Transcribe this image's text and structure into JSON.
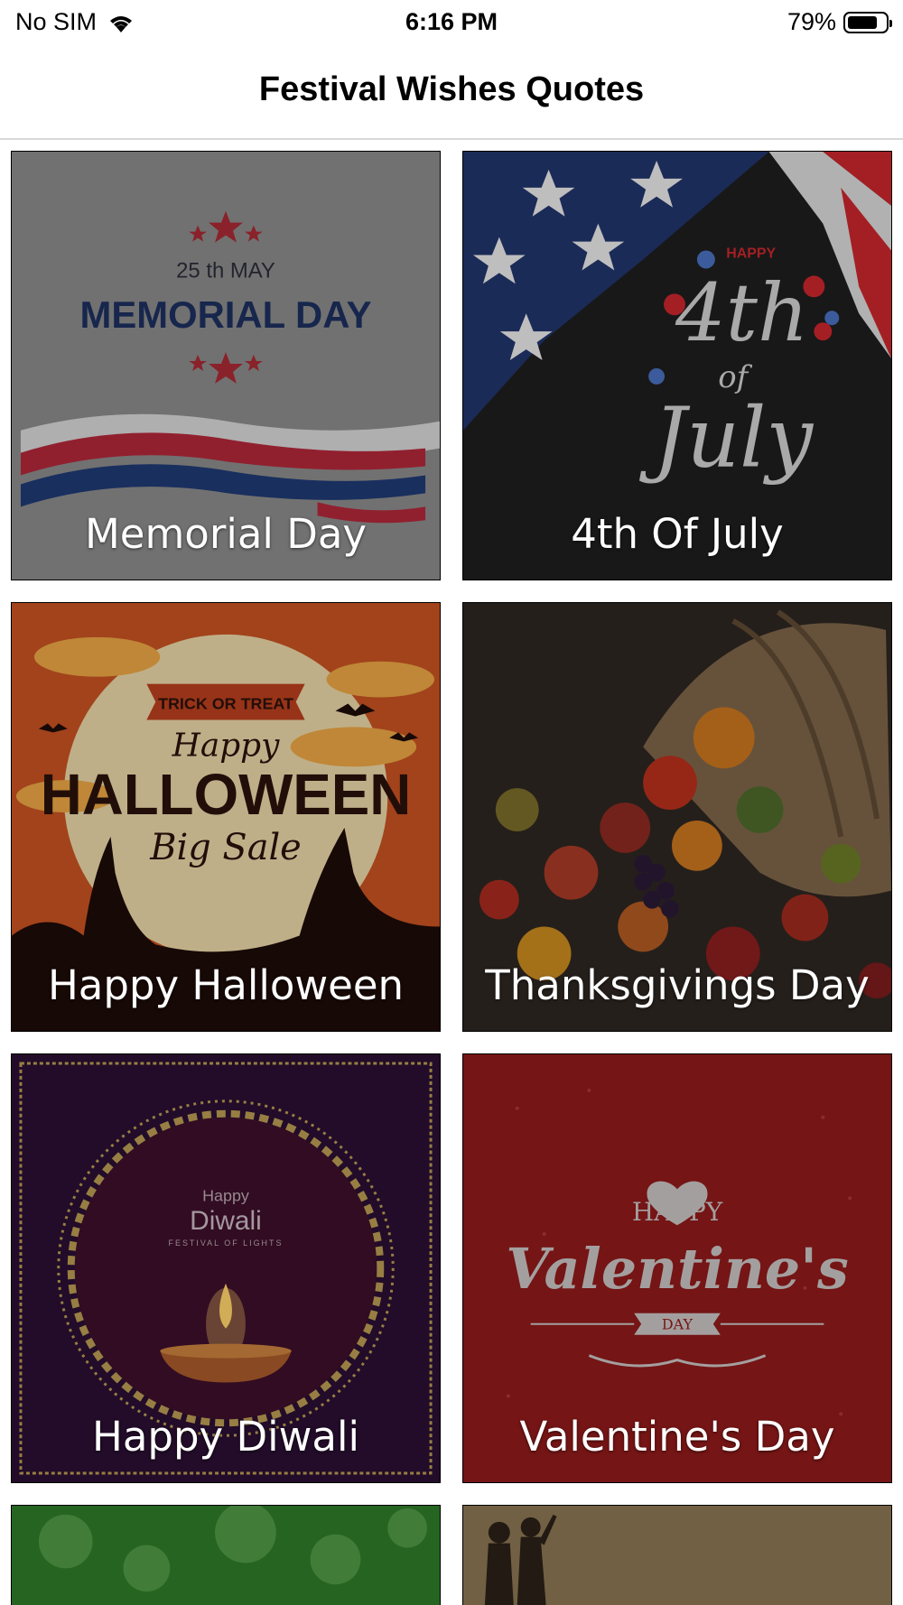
{
  "status_bar": {
    "carrier": "No SIM",
    "time": "6:16 PM",
    "battery_percent": "79%",
    "battery_level": 0.79,
    "icons": [
      "wifi-icon",
      "battery-icon"
    ]
  },
  "nav": {
    "title": "Festival Wishes Quotes"
  },
  "cards": [
    {
      "label": "Memorial Day",
      "art_date": "25 th MAY",
      "art_heading": "MEMORIAL DAY",
      "colors": {
        "bg": "#8a8a8a",
        "heading": "#1d2f5e",
        "stripe_red": "#b1283a",
        "stripe_blue": "#1f3a73"
      }
    },
    {
      "label": "4th Of July",
      "art_top": "HAPPY",
      "art_main": "4th",
      "art_mid": "of",
      "art_bottom": "July",
      "colors": {
        "bg": "#1e1e1e",
        "flag_blue": "#22356b",
        "flag_red": "#c9262c"
      }
    },
    {
      "label": "Happy Halloween",
      "art_banner": "TRICK OR TREAT",
      "art_line1": "Happy",
      "art_line2": "HALLOWEEN",
      "art_line3": "Big Sale",
      "colors": {
        "bg": "#c65222",
        "moon": "#e9d6a6",
        "ink": "#2a120c"
      }
    },
    {
      "label": "Thanksgivings Day",
      "colors": {
        "bg": "#2e2721",
        "basket": "#7d6548"
      }
    },
    {
      "label": "Happy Diwali",
      "art_small": "Happy",
      "art_main": "Diwali",
      "art_sub": "FESTIVAL OF LIGHTS",
      "colors": {
        "bg": "#2a0f33",
        "frame": "#b99a52",
        "flame": "#ffd36b"
      }
    },
    {
      "label": "Valentine's Day",
      "art_top": "HAPPY",
      "art_main": "Valentine's",
      "art_ribbon": "DAY",
      "colors": {
        "bg": "#8f1a1a",
        "ink": "#c9c3c3"
      }
    },
    {
      "label": "",
      "colors": {
        "bg": "#2f7a2a"
      }
    },
    {
      "label": "",
      "colors": {
        "bg": "#8a7652"
      }
    }
  ]
}
